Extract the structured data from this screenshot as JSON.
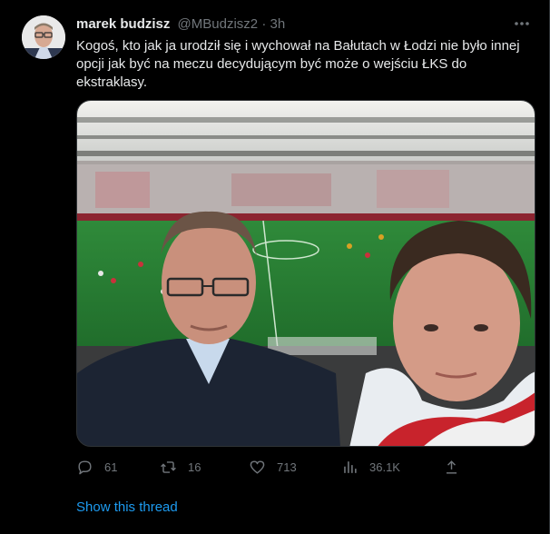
{
  "tweet": {
    "author_name": "marek budzisz",
    "handle": "@MBudzisz2",
    "separator": "·",
    "time": "3h",
    "text": "Kogoś, kto jak ja urodził się i wychował na Bałutach w Łodzi nie było innej opcji jak być na meczu decydującym być może o wejściu ŁKS do ekstraklasy.",
    "more_icon": "more-horizontal-icon",
    "image_alt_icon": "stadium-selfie-photo"
  },
  "actions": {
    "replies": "61",
    "retweets": "16",
    "likes": "713",
    "views": "36.1K"
  },
  "show_thread": "Show this thread",
  "colors": {
    "background": "#000000",
    "text": "#e7e9ea",
    "secondary": "#71767b",
    "link": "#1d9bf0"
  }
}
